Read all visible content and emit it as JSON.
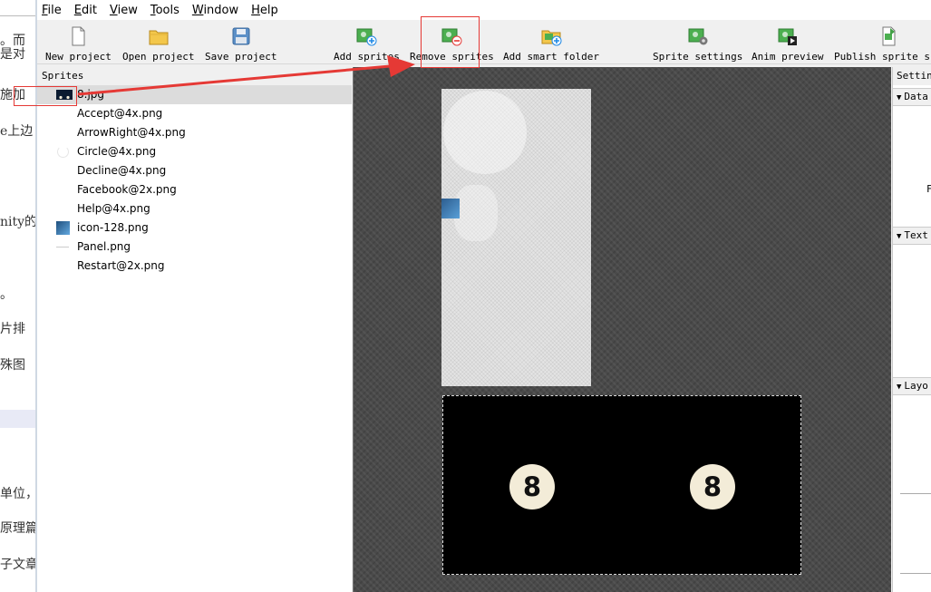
{
  "background_page": {
    "fragments": [
      "。而",
      "是对",
      "施加",
      "e上边",
      "nity的",
      "。",
      "片排",
      "殊图",
      "单位，",
      "原理篇",
      "子文章"
    ]
  },
  "menubar": {
    "items": [
      {
        "label": "File",
        "accel": "F"
      },
      {
        "label": "Edit",
        "accel": "E"
      },
      {
        "label": "View",
        "accel": "V"
      },
      {
        "label": "Tools",
        "accel": "T"
      },
      {
        "label": "Window",
        "accel": "W"
      },
      {
        "label": "Help",
        "accel": "H"
      }
    ]
  },
  "toolbar": {
    "new_project": "New project",
    "open_project": "Open project",
    "save_project": "Save project",
    "add_sprites": "Add sprites",
    "remove_sprites": "Remove sprites",
    "add_smart_folder": "Add smart folder",
    "sprite_settings": "Sprite settings",
    "anim_preview": "Anim preview",
    "publish_sprite_sheet": "Publish sprite she"
  },
  "sprites_panel": {
    "title": "Sprites",
    "items": [
      {
        "name": "8.jpg",
        "thumb": "dark-balls",
        "selected": true
      },
      {
        "name": "Accept@4x.png",
        "thumb": "none"
      },
      {
        "name": "ArrowRight@4x.png",
        "thumb": "none"
      },
      {
        "name": "Circle@4x.png",
        "thumb": "circle"
      },
      {
        "name": "Decline@4x.png",
        "thumb": "none"
      },
      {
        "name": "Facebook@2x.png",
        "thumb": "none"
      },
      {
        "name": "Help@4x.png",
        "thumb": "none"
      },
      {
        "name": "icon-128.png",
        "thumb": "blue-icon"
      },
      {
        "name": "Panel.png",
        "thumb": "line"
      },
      {
        "name": "Restart@2x.png",
        "thumb": "none"
      }
    ]
  },
  "canvas": {
    "ball_left": "8",
    "ball_right": "8"
  },
  "settings_panel": {
    "title": "Setting",
    "data_section": "Data",
    "data_letter": "F",
    "texture_section": "Text",
    "layout_section": "Layo"
  },
  "colors": {
    "annotation": "#e53935",
    "canvas_bg": "#4a4a4a",
    "selection": "#dcdcdc"
  }
}
